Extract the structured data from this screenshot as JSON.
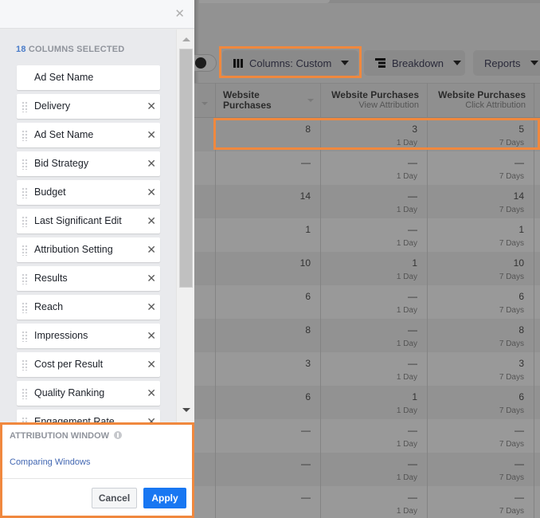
{
  "panel": {
    "selected_count": "18",
    "selected_label": "COLUMNS SELECTED",
    "close_icon": "close-icon",
    "pinned_item": "Ad Set Name",
    "items": [
      {
        "label": "Delivery"
      },
      {
        "label": "Ad Set Name"
      },
      {
        "label": "Bid Strategy"
      },
      {
        "label": "Budget"
      },
      {
        "label": "Last Significant Edit"
      },
      {
        "label": "Attribution Setting"
      },
      {
        "label": "Results"
      },
      {
        "label": "Reach"
      },
      {
        "label": "Impressions"
      },
      {
        "label": "Cost per Result"
      },
      {
        "label": "Quality Ranking"
      },
      {
        "label": "Engagement Rate"
      }
    ],
    "remove_glyph": "✕",
    "footer": {
      "title": "ATTRIBUTION WINDOW",
      "link": "Comparing Windows",
      "cancel": "Cancel",
      "apply": "Apply"
    }
  },
  "toolbar": {
    "columns": "Columns: Custom",
    "breakdown": "Breakdown",
    "reports": "Reports"
  },
  "table": {
    "headers": [
      {
        "title": "Website Purchases",
        "line1": "Website",
        "line2": "Purchases",
        "sub": ""
      },
      {
        "title": "Website Purchases",
        "sub": "View Attribution"
      },
      {
        "title": "Website Purchases",
        "sub": "Click Attribution"
      }
    ],
    "rows": [
      {
        "total": "8",
        "view": "3",
        "view_window": "1 Day",
        "click": "5",
        "click_window": "7 Days"
      },
      {
        "total": "—",
        "view": "—",
        "view_window": "1 Day",
        "click": "—",
        "click_window": "7 Days"
      },
      {
        "total": "14",
        "view": "—",
        "view_window": "1 Day",
        "click": "14",
        "click_window": "7 Days"
      },
      {
        "total": "1",
        "view": "—",
        "view_window": "1 Day",
        "click": "1",
        "click_window": "7 Days"
      },
      {
        "total": "10",
        "view": "1",
        "view_window": "1 Day",
        "click": "10",
        "click_window": "7 Days"
      },
      {
        "total": "6",
        "view": "—",
        "view_window": "1 Day",
        "click": "6",
        "click_window": "7 Days"
      },
      {
        "total": "8",
        "view": "—",
        "view_window": "1 Day",
        "click": "8",
        "click_window": "7 Days"
      },
      {
        "total": "3",
        "view": "—",
        "view_window": "1 Day",
        "click": "3",
        "click_window": "7 Days"
      },
      {
        "total": "6",
        "view": "1",
        "view_window": "1 Day",
        "click": "6",
        "click_window": "7 Days"
      },
      {
        "total": "—",
        "view": "—",
        "view_window": "1 Day",
        "click": "—",
        "click_window": "7 Days"
      },
      {
        "total": "—",
        "view": "—",
        "view_window": "1 Day",
        "click": "—",
        "click_window": "7 Days"
      },
      {
        "total": "—",
        "view": "—",
        "view_window": "1 Day",
        "click": "—",
        "click_window": "7 Days"
      }
    ]
  },
  "colors": {
    "highlight": "#f0883e",
    "accent_blue": "#1877f2",
    "link_blue": "#4267b2"
  }
}
